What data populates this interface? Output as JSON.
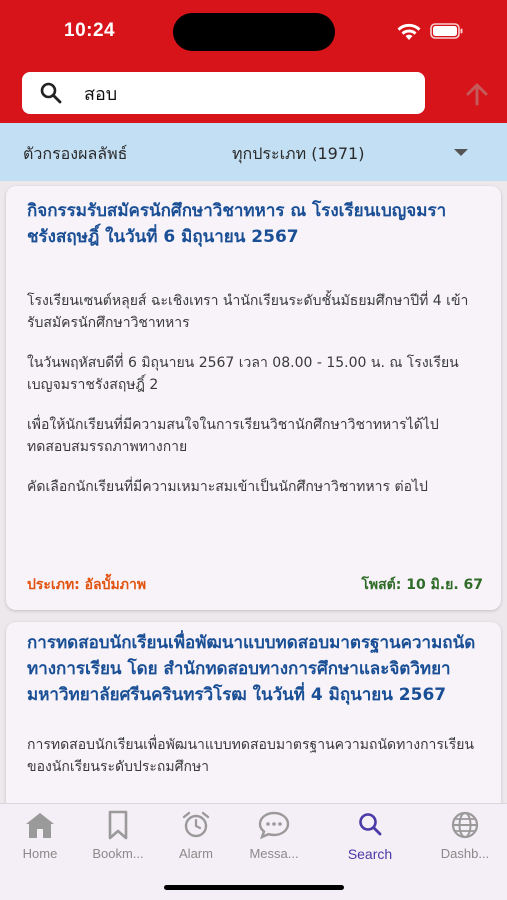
{
  "status_bar": {
    "time": "10:24"
  },
  "search": {
    "value": "สอบ"
  },
  "filter": {
    "label": "ตัวกรองผลลัพธ์",
    "selected": "ทุกประเภท (1971)"
  },
  "results": [
    {
      "title": "กิจกรรมรับสมัครนักศึกษาวิชาทหาร ณ โรงเรียนเบญจมราชรังสฤษฎิ์ ในวันที่ 6 มิถุนายน 2567",
      "paragraphs": [
        "โรงเรียนเซนต์หลุยส์ ฉะเชิงเทรา นำนักเรียนระดับชั้นมัธยมศึกษาปีที่ 4 เข้ารับสมัครนักศึกษาวิชาทหาร",
        "ในวันพฤหัสบดีที่ 6 มิถุนายน 2567 เวลา 08.00 - 15.00 น. ณ โรงเรียนเบญจมราชรังสฤษฎิ์ 2",
        "เพื่อให้นักเรียนที่มีความสนใจในการเรียนวิชานักศึกษาวิชาทหารได้ไปทดสอบสมรรถภาพทางกาย",
        "คัดเลือกนักเรียนที่มีความเหมาะสมเข้าเป็นนักศึกษาวิชาทหาร ต่อไป"
      ],
      "type": "ประเภท: อัลบั้มภาพ",
      "posted": "โพสต์: 10 มิ.ย. 67"
    },
    {
      "title": "การทดสอบนักเรียนเพื่อพัฒนาแบบทดสอบมาตรฐานความถนัดทางการเรียน โดย สำนักทดสอบทางการศึกษาและจิตวิทยา มหาวิทยาลัยศรีนครินทรวิโรฒ  ในวันที่ 4 มิถุนายน 2567",
      "paragraphs": [
        "การทดสอบนักเรียนเพื่อพัฒนาแบบทดสอบมาตรฐานความถนัดทางการเรียน ของนักเรียนระดับประถมศึกษา"
      ]
    }
  ],
  "tabs": [
    {
      "label": "Home",
      "icon": "home-icon"
    },
    {
      "label": "Bookm...",
      "icon": "bookmark-icon"
    },
    {
      "label": "Alarm",
      "icon": "alarm-icon"
    },
    {
      "label": "Messa...",
      "icon": "message-icon"
    },
    {
      "label": "Search",
      "icon": "search-icon",
      "active": true
    },
    {
      "label": "Dashb...",
      "icon": "globe-icon"
    }
  ],
  "colors": {
    "header": "#d8141b",
    "filter_bar": "#c3dff4",
    "title": "#1a4f95",
    "type": "#e2530f",
    "posted": "#2e6b27",
    "active_tab": "#4a3aa8"
  }
}
